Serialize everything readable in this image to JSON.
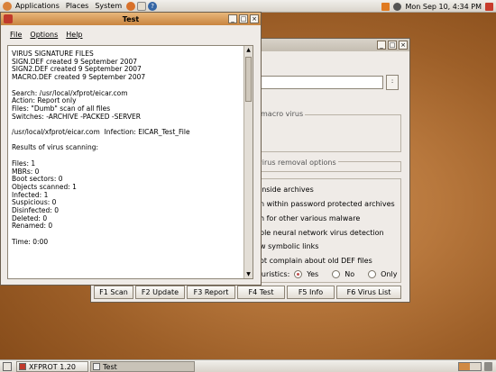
{
  "top_panel": {
    "menus": [
      "Applications",
      "Places",
      "System"
    ],
    "clock": "Mon Sep 10,  4:34 PM"
  },
  "xfprot": {
    "title": "XFPROT 1.20",
    "frame1_label": "macro virus",
    "frame2_label": "virus removal options",
    "options": [
      "inside archives",
      "n within password protected archives",
      "h for other various malware",
      "ble neural network virus detection",
      "w symbolic links",
      "ot complain about old DEF files"
    ],
    "heuristics_label": "euristics:",
    "radios": [
      {
        "label": "Yes",
        "selected": true
      },
      {
        "label": "No",
        "selected": false
      },
      {
        "label": "Only",
        "selected": false
      }
    ],
    "fkeys": [
      "F1 Scan",
      "F2 Update",
      "F3 Report",
      "F4 Test",
      "F5 Info",
      "F6 Virus List"
    ]
  },
  "test_window": {
    "title": "Test",
    "menu": [
      "File",
      "Options",
      "Help"
    ],
    "lines": [
      "VIRUS SIGNATURE FILES",
      "SIGN.DEF created 9 September 2007",
      "SIGN2.DEF created 9 September 2007",
      "MACRO.DEF created 9 September 2007",
      "",
      "Search: /usr/local/xfprot/eicar.com",
      "Action: Report only",
      "Files: \"Dumb\" scan of all files",
      "Switches: -ARCHIVE -PACKED -SERVER",
      "",
      "/usr/local/xfprot/eicar.com  Infection: EICAR_Test_File",
      "",
      "Results of virus scanning:",
      "",
      "Files: 1",
      "MBRs: 0",
      "Boot sectors: 0",
      "Objects scanned: 1",
      "Infected: 1",
      "Suspicious: 0",
      "Disinfected: 0",
      "Deleted: 0",
      "Renamed: 0",
      "",
      "Time: 0:00",
      ""
    ]
  },
  "taskbar": {
    "items": [
      "XFPROT 1.20",
      "Test"
    ]
  },
  "colors": {
    "desktop": "#b8783d",
    "active_title": "#d8964f",
    "window_bg": "#efebe7"
  }
}
